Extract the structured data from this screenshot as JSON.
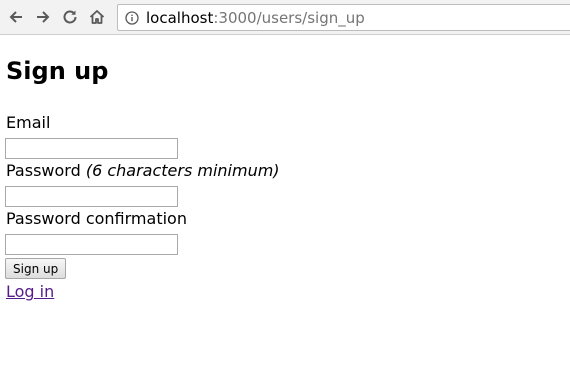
{
  "browser": {
    "url_host": "localhost",
    "url_path": ":3000/users/sign_up"
  },
  "page": {
    "title": "Sign up",
    "email_label": "Email",
    "email_value": "",
    "password_label": "Password",
    "password_hint": "(6 characters minimum)",
    "password_value": "",
    "password_confirmation_label": "Password confirmation",
    "password_confirmation_value": "",
    "submit_label": "Sign up",
    "login_link": "Log in"
  }
}
